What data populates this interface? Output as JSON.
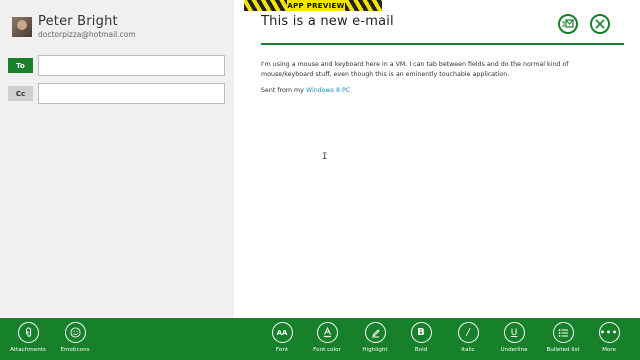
{
  "banner": {
    "label": "APP PREVIEW"
  },
  "account": {
    "name": "Peter Bright",
    "email": "doctorpizza@hotmail.com"
  },
  "fields": {
    "to_label": "To",
    "cc_label": "Cc",
    "to_value": "",
    "cc_value": ""
  },
  "compose": {
    "subject": "This is a new e-mail",
    "body": "I'm using a mouse and keyboard here in a VM. I can tab between fields and do the normal kind of mouse/keyboard stuff, even though this is an eminently touchable application.",
    "signature_prefix": "Sent from my ",
    "signature_link": "Windows 8 PC"
  },
  "colors": {
    "accent": "#16802a",
    "link": "#1a8fbf",
    "banner": "#f2e600"
  },
  "appbar": {
    "attachments": "Attachments",
    "emoticons": "Emoticons",
    "font": "Font",
    "font_color": "Font color",
    "highlight": "Highlight",
    "bold": "Bold",
    "italic": "Italic",
    "underline": "Underline",
    "bulleted_list": "Bulleted list",
    "more": "More"
  }
}
